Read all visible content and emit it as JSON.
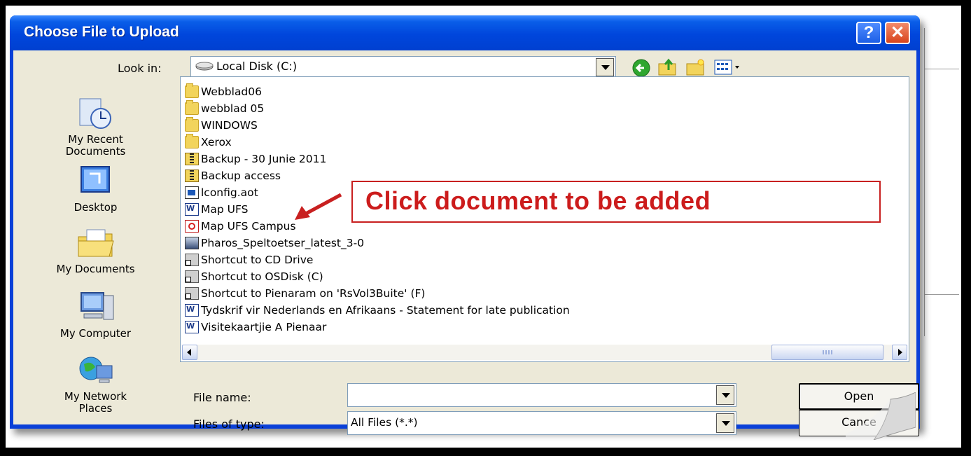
{
  "window": {
    "title": "Choose File to Upload",
    "help_label": "?",
    "close_label": "✕"
  },
  "toolbar": {
    "look_in_label": "Look in:",
    "look_in_value": "Local Disk (C:)",
    "icons": [
      "back-icon",
      "up-folder-icon",
      "new-folder-icon",
      "views-menu-icon"
    ]
  },
  "places": [
    {
      "label": "My Recent Documents",
      "line1": "My Recent",
      "line2": "Documents",
      "icon": "recent-documents-icon"
    },
    {
      "label": "Desktop",
      "icon": "desktop-icon"
    },
    {
      "label": "My Documents",
      "icon": "my-documents-icon"
    },
    {
      "label": "My Computer",
      "icon": "my-computer-icon"
    },
    {
      "label": "My Network Places",
      "line1": "My Network",
      "line2": "Places",
      "icon": "network-places-icon"
    }
  ],
  "files": [
    {
      "name": "Webblad06",
      "type": "folder"
    },
    {
      "name": "webblad 05",
      "type": "folder"
    },
    {
      "name": "WINDOWS",
      "type": "folder"
    },
    {
      "name": "Xerox",
      "type": "folder"
    },
    {
      "name": "Backup - 30 Junie 2011",
      "type": "zip"
    },
    {
      "name": "Backup access",
      "type": "zip"
    },
    {
      "name": "lconfig.aot",
      "type": "aot"
    },
    {
      "name": "Map UFS",
      "type": "word"
    },
    {
      "name": "Map UFS Campus",
      "type": "pdf"
    },
    {
      "name": "Pharos_Speltoetser_latest_3-0",
      "type": "exe"
    },
    {
      "name": "Shortcut to CD Drive",
      "type": "shortcut"
    },
    {
      "name": "Shortcut to OSDisk (C)",
      "type": "shortcut"
    },
    {
      "name": "Shortcut to Pienaram on 'RsVol3Buite' (F)",
      "type": "shortcut"
    },
    {
      "name": "Tydskrif vir Nederlands en Afrikaans - Statement for late publication",
      "type": "word"
    },
    {
      "name": "Visitekaartjie A Pienaar",
      "type": "word"
    }
  ],
  "form": {
    "file_name_label": "File name:",
    "file_name_value": "",
    "files_of_type_label": "Files of type:",
    "files_of_type_value": "All Files (*.*)",
    "open_label": "Open",
    "cancel_label": "Cance"
  },
  "annotation": {
    "text": "Click document to be added",
    "color": "#cc1c1c"
  },
  "colors": {
    "titlebar": "#0046dc",
    "dialog_face": "#ece9d8",
    "close_button": "#d8441c"
  }
}
